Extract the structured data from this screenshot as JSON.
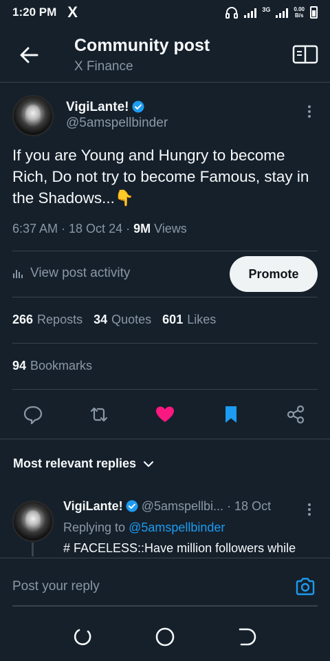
{
  "status_bar": {
    "time": "1:20 PM",
    "app_logo": "X",
    "network_label": "3G",
    "speed_value": "0.00",
    "speed_unit": "B/s"
  },
  "header": {
    "title": "Community post",
    "subtitle": "X Finance"
  },
  "post": {
    "author_name": "VigiLante!",
    "author_handle": "@5amspellbinder",
    "text": "If you are Young and Hungry to become Rich, Do not try to become Famous, stay in the Shadows...👇",
    "time": "6:37 AM · 18 Oct 24 · ",
    "views_count": "9M",
    "views_label": " Views",
    "activity_label": "View post activity",
    "promote_label": "Promote",
    "reposts_count": "266",
    "reposts_label": "Reposts",
    "quotes_count": "34",
    "quotes_label": "Quotes",
    "likes_count": "601",
    "likes_label": "Likes",
    "bookmarks_count": "94",
    "bookmarks_label": "Bookmarks",
    "liked": true,
    "bookmarked": true
  },
  "colors": {
    "background": "#15202b",
    "accent": "#1d9bf0",
    "like": "#f91880",
    "muted": "#8b98a5"
  },
  "replies": {
    "sort_label": "Most relevant replies",
    "items": [
      {
        "author_name": "VigiLante!",
        "author_handle": "@5amspellbi...",
        "date": "· 18 Oct",
        "replying_prefix": "Replying to ",
        "replying_to": "@5amspellbinder",
        "text": "# FACELESS::Have million followers while"
      }
    ]
  },
  "composer": {
    "placeholder": "Post your reply"
  }
}
